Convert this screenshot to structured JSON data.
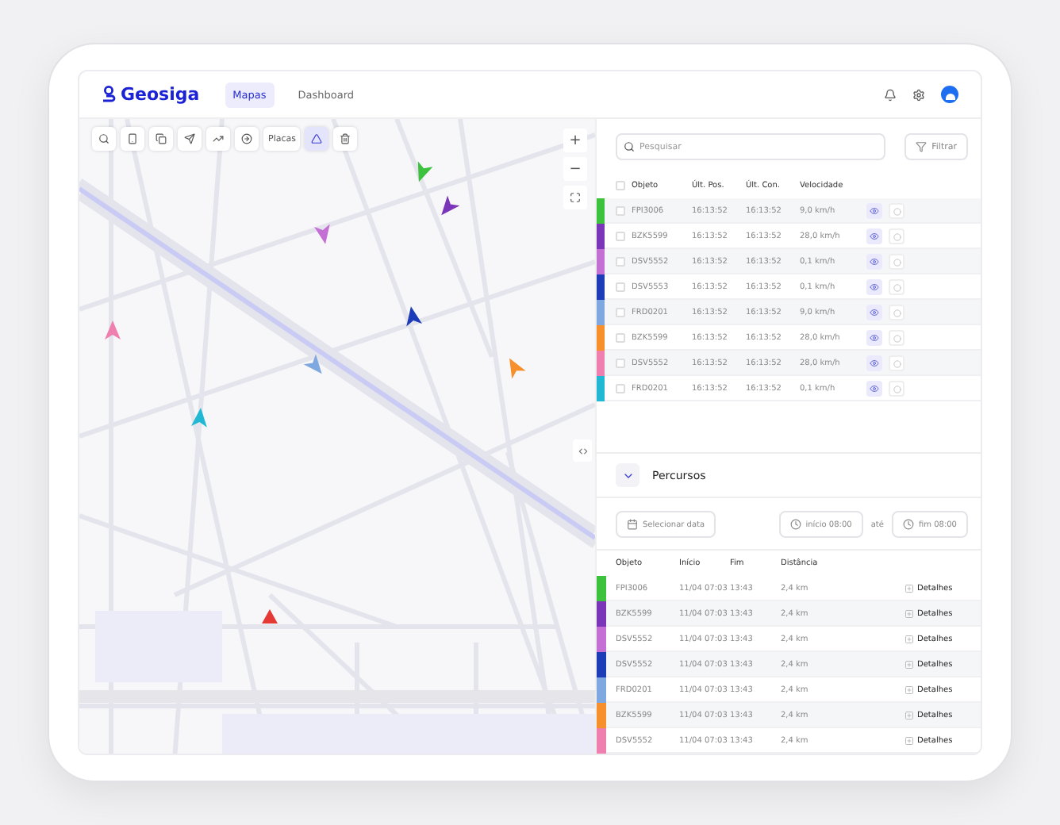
{
  "header": {
    "logo": "Geosiga",
    "nav": [
      {
        "label": "Mapas",
        "selected": true
      },
      {
        "label": "Dashboard",
        "selected": false
      }
    ]
  },
  "map": {
    "tools": [
      {
        "kind": "search",
        "selected": false
      },
      {
        "kind": "phone",
        "selected": false
      },
      {
        "kind": "copy",
        "selected": false
      },
      {
        "kind": "send",
        "selected": false
      },
      {
        "kind": "trend",
        "selected": false
      },
      {
        "kind": "target",
        "selected": false
      },
      {
        "kind": "label",
        "label": "Placas",
        "selected": false
      },
      {
        "kind": "triangle",
        "selected": true
      },
      {
        "kind": "trash",
        "selected": false
      }
    ],
    "zoom_in": "+",
    "zoom_out": "−"
  },
  "tracking": {
    "select_all_checked": false,
    "search": {
      "placeholder": "Pesquisar"
    },
    "filter": "Filtrar",
    "columns": [
      "Objeto",
      "Últ. Pos.",
      "Últ. Con.",
      "Velocidade"
    ],
    "rows": [
      {
        "color": "#3cc23c",
        "objeto": "FPI3006",
        "pos": "16:13:52",
        "con": "16:13:52",
        "velocidade": "9,0 km/h",
        "checked": false
      },
      {
        "color": "#7b35b8",
        "objeto": "BZK5599",
        "pos": "16:13:52",
        "con": "16:13:52",
        "velocidade": "28,0 km/h",
        "checked": false
      },
      {
        "color": "#c36fd3",
        "objeto": "DSV5552",
        "pos": "16:13:52",
        "con": "16:13:52",
        "velocidade": "0,1 km/h",
        "checked": false
      },
      {
        "color": "#1d3db8",
        "objeto": "DSV5553",
        "pos": "16:13:52",
        "con": "16:13:52",
        "velocidade": "0,1 km/h",
        "checked": false
      },
      {
        "color": "#7fa8e0",
        "objeto": "FRD0201",
        "pos": "16:13:52",
        "con": "16:13:52",
        "velocidade": "9,0 km/h",
        "checked": false
      },
      {
        "color": "#f7902a",
        "objeto": "BZK5599",
        "pos": "16:13:52",
        "con": "16:13:52",
        "velocidade": "28,0 km/h",
        "checked": false
      },
      {
        "color": "#ef7fae",
        "objeto": "DSV5552",
        "pos": "16:13:52",
        "con": "16:13:52",
        "velocidade": "28,0 km/h",
        "checked": false
      },
      {
        "color": "#21b8d4",
        "objeto": "FRD0201",
        "pos": "16:13:52",
        "con": "16:13:52",
        "velocidade": "0,1 km/h",
        "checked": false
      }
    ]
  },
  "routes": {
    "title": "Percursos",
    "expanded": true,
    "date_button": "Selecionar data",
    "start": "início 08:00",
    "separator": "até",
    "end": "fim 08:00",
    "columns": [
      "Objeto",
      "Início",
      "Fim",
      "Distância"
    ],
    "rows": [
      {
        "color": "#3cc23c",
        "objeto": "FPI3006",
        "inicio": "11/04 07:03",
        "fim": "13:43",
        "distancia": "2,4 km",
        "action": "Detalhes"
      },
      {
        "color": "#7b35b8",
        "objeto": "BZK5599",
        "inicio": "11/04 07:03",
        "fim": "13:43",
        "distancia": "2,4 km",
        "action": "Detalhes"
      },
      {
        "color": "#c36fd3",
        "objeto": "DSV5552",
        "inicio": "11/04 07:03",
        "fim": "13:43",
        "distancia": "2,4 km",
        "action": "Detalhes"
      },
      {
        "color": "#1d3db8",
        "objeto": "DSV5552",
        "inicio": "11/04 07:03",
        "fim": "13:43",
        "distancia": "2,4 km",
        "action": "Detalhes"
      },
      {
        "color": "#7fa8e0",
        "objeto": "FRD0201",
        "inicio": "11/04 07:03",
        "fim": "13:43",
        "distancia": "2,4 km",
        "action": "Detalhes"
      },
      {
        "color": "#f7902a",
        "objeto": "BZK5599",
        "inicio": "11/04 07:03",
        "fim": "13:43",
        "distancia": "2,4 km",
        "action": "Detalhes"
      },
      {
        "color": "#ef7fae",
        "objeto": "DSV5552",
        "inicio": "11/04 07:03",
        "fim": "13:43",
        "distancia": "2,4 km",
        "action": "Detalhes"
      }
    ]
  }
}
